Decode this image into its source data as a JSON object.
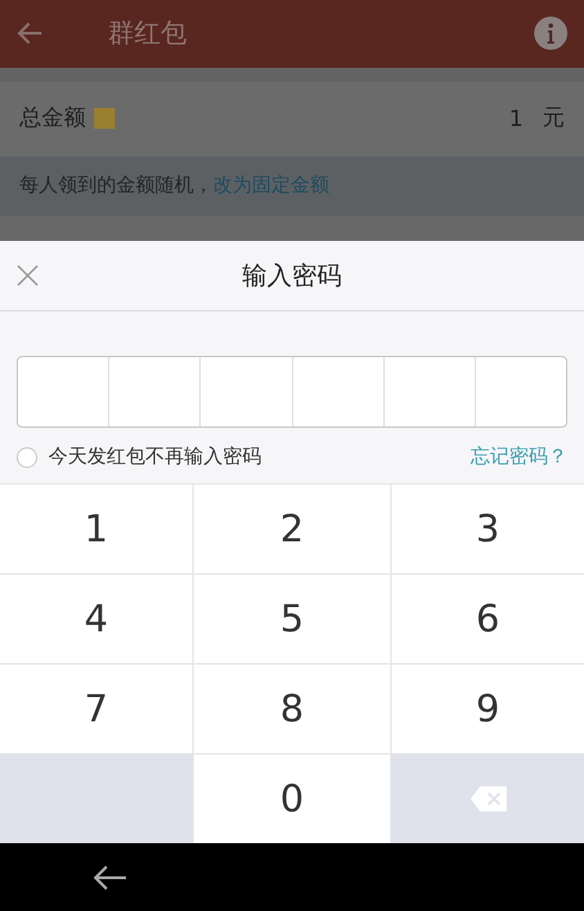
{
  "header": {
    "title": "群红包"
  },
  "amount": {
    "label": "总金额",
    "value": "1",
    "unit": "元"
  },
  "hint": {
    "text": "每人领到的金额随机，",
    "link": "改为固定金额"
  },
  "dialog": {
    "title": "输入密码",
    "pin_cells": [
      {
        "filled": false
      },
      {
        "filled": false
      },
      {
        "filled": false
      },
      {
        "filled": false
      },
      {
        "filled": false
      },
      {
        "filled": false
      }
    ],
    "remember": {
      "label": "今天发红包不再输入密码",
      "checked": false
    },
    "forgot_link": "忘记密码？"
  },
  "keys": [
    {
      "kind": "digit",
      "label": "1"
    },
    {
      "kind": "digit",
      "label": "2"
    },
    {
      "kind": "digit",
      "label": "3"
    },
    {
      "kind": "digit",
      "label": "4"
    },
    {
      "kind": "digit",
      "label": "5"
    },
    {
      "kind": "digit",
      "label": "6"
    },
    {
      "kind": "digit",
      "label": "7"
    },
    {
      "kind": "digit",
      "label": "8"
    },
    {
      "kind": "digit",
      "label": "9"
    },
    {
      "kind": "blank"
    },
    {
      "kind": "digit",
      "label": "0"
    },
    {
      "kind": "backspace"
    }
  ]
}
